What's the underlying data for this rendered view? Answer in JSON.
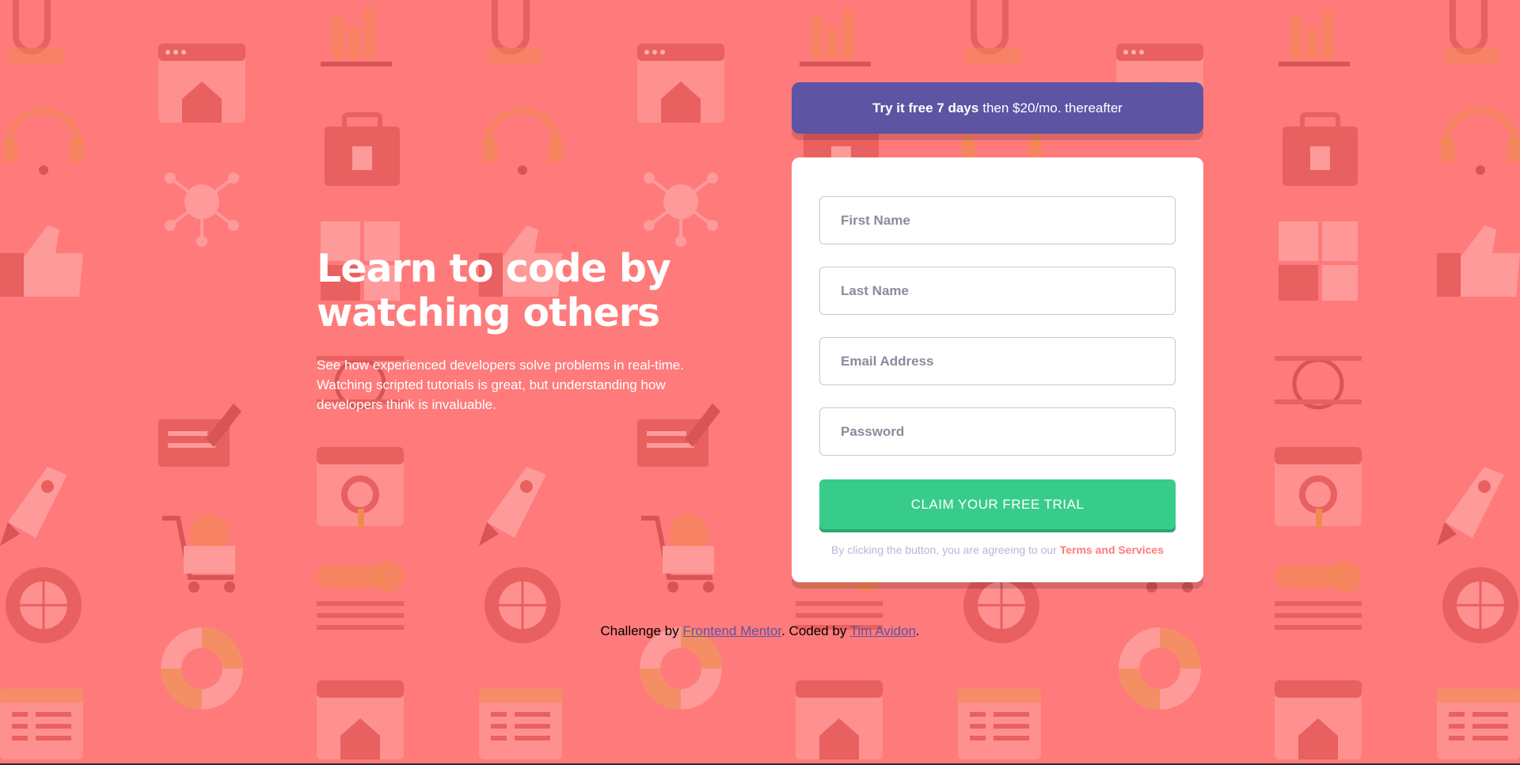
{
  "colors": {
    "background": "#ff7a7a",
    "pattern": "#e8605f",
    "promo": "#5e54a4",
    "cta": "#38cc8b",
    "link": "#5e54a4",
    "terms_link": "#ff7a7a"
  },
  "hero": {
    "title_line1": "Learn to code by",
    "title_line2": "watching others",
    "desc_line1": "See how experienced developers solve problems in real-time.",
    "desc_line2": "Watching scripted tutorials is great, but understanding how",
    "desc_line3": "developers think is invaluable."
  },
  "promo": {
    "bold": "Try it free 7 days",
    "rest": "then $20/mo. thereafter"
  },
  "form": {
    "first_name": {
      "placeholder": "First Name",
      "value": ""
    },
    "last_name": {
      "placeholder": "Last Name",
      "value": ""
    },
    "email": {
      "placeholder": "Email Address",
      "value": ""
    },
    "password": {
      "placeholder": "Password",
      "value": ""
    },
    "submit_label": "CLAIM YOUR FREE TRIAL",
    "terms_text": "By clicking the button, you are agreeing to our",
    "terms_link": "Terms and Services"
  },
  "footer": {
    "challenge_text": "Challenge by",
    "frontend_mentor": "Frontend Mentor",
    "coded_text": ". Coded by",
    "author": "Tim Avidon",
    "period": "."
  },
  "background_icons": [
    "location-icon",
    "chart-icon",
    "browser-home-icon",
    "headset-icon",
    "toolbox-icon",
    "network-icon",
    "thumbs-up-icon",
    "puzzle-icon",
    "folder-gear-icon",
    "pencil-note-icon",
    "rocket-icon",
    "magnifier-browser-icon",
    "cart-gear-icon",
    "globe-gear-icon",
    "key-icon",
    "lifebuoy-icon",
    "calendar-list-icon",
    "target-icon"
  ]
}
